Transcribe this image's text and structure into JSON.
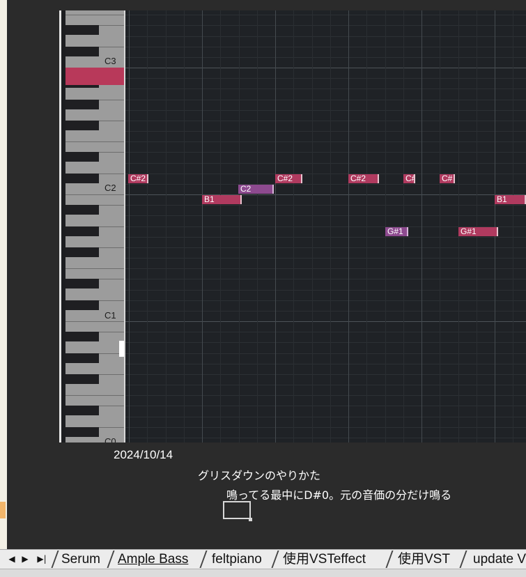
{
  "piano_roll": {
    "key_labels": [
      "C3",
      "C2",
      "C1",
      "C0"
    ],
    "notes": [
      {
        "label": "C#2",
        "color": "red"
      },
      {
        "label": "B1",
        "color": "red"
      },
      {
        "label": "C2",
        "color": "purple"
      },
      {
        "label": "C#2",
        "color": "red"
      },
      {
        "label": "C#2",
        "color": "red"
      },
      {
        "label": "C#",
        "color": "red"
      },
      {
        "label": "C#",
        "color": "red"
      },
      {
        "label": "B1",
        "color": "red"
      },
      {
        "label": "G#1",
        "color": "purple"
      },
      {
        "label": "G#1",
        "color": "red"
      }
    ],
    "colors": {
      "note_red": "#b03a5f",
      "note_purple": "#8d4a8f",
      "key_highlight": "#b8395a"
    }
  },
  "sheet_text": {
    "date": "2024/10/14",
    "line1": "グリスダウンのやりかた",
    "line2": "鳴ってる最中にD#0。元の音価の分だけ鳴る"
  },
  "tabs": {
    "nav_icons": [
      "first-sheet-icon",
      "prev-sheet-icon",
      "next-sheet-icon",
      "last-sheet-icon"
    ],
    "items": [
      "Serum",
      "Ample Bass",
      "feltpiano",
      "使用VSTeffect",
      "使用VST",
      "update V"
    ],
    "active_index": 1
  }
}
